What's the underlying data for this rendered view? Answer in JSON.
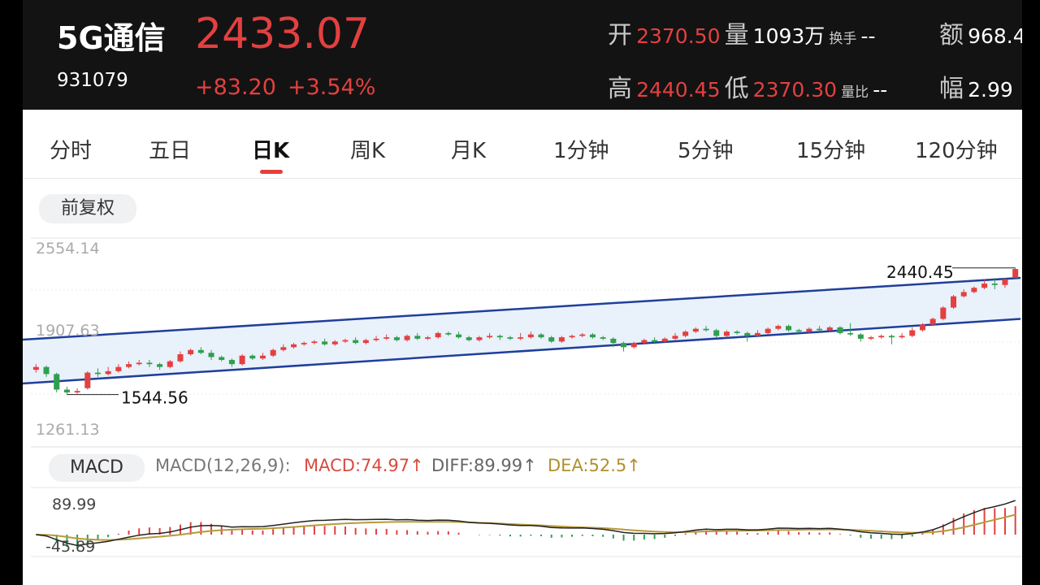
{
  "header": {
    "name": "5G通信",
    "code": "931079",
    "price": "2433.07",
    "change": "+83.20",
    "change_pct": "+3.54%",
    "open_label": "开",
    "open": "2370.50",
    "volume_label": "量",
    "volume": "1093万",
    "turnover_label": "换手",
    "turnover": "--",
    "amount_label": "额",
    "amount": "968.4",
    "high_label": "高",
    "high": "2440.45",
    "low_label": "低",
    "low": "2370.30",
    "vol_ratio_label": "量比",
    "vol_ratio": "--",
    "amplitude_label": "幅",
    "amplitude": "2.99"
  },
  "tabs": [
    "分时",
    "五日",
    "日K",
    "周K",
    "月K",
    "1分钟",
    "5分钟",
    "15分钟",
    "120分钟"
  ],
  "active_tab": "日K",
  "adjust_button": "前复权",
  "indicator": {
    "button": "MACD",
    "params": "MACD(12,26,9):",
    "macd": "MACD:74.97",
    "diff": "DIFF:89.99",
    "dea": "DEA:52.5",
    "arrow": "↑"
  },
  "colors": {
    "up": "#e34040",
    "down": "#2e9f4e",
    "channel": "#1f3f9a",
    "dea": "#b89a3a",
    "diff": "#222222"
  },
  "chart_data": {
    "type": "candlestick",
    "y_ticks": [
      "2554.14",
      "1907.63",
      "1261.13"
    ],
    "ylim": [
      1261.13,
      2554.14
    ],
    "annotations": {
      "max": "2440.45",
      "min": "1544.56"
    },
    "candles": [
      [
        1720,
        1740,
        1700,
        1760
      ],
      [
        1740,
        1690,
        1670,
        1750
      ],
      [
        1690,
        1580,
        1560,
        1700
      ],
      [
        1580,
        1560,
        1544.56,
        1600
      ],
      [
        1560,
        1570,
        1550,
        1590
      ],
      [
        1590,
        1700,
        1580,
        1710
      ],
      [
        1700,
        1690,
        1670,
        1730
      ],
      [
        1690,
        1710,
        1680,
        1740
      ],
      [
        1710,
        1740,
        1700,
        1760
      ],
      [
        1740,
        1760,
        1730,
        1780
      ],
      [
        1760,
        1770,
        1750,
        1790
      ],
      [
        1770,
        1760,
        1740,
        1790
      ],
      [
        1760,
        1740,
        1720,
        1770
      ],
      [
        1740,
        1780,
        1730,
        1790
      ],
      [
        1780,
        1830,
        1770,
        1850
      ],
      [
        1830,
        1860,
        1820,
        1870
      ],
      [
        1860,
        1840,
        1830,
        1880
      ],
      [
        1840,
        1810,
        1790,
        1860
      ],
      [
        1810,
        1790,
        1780,
        1820
      ],
      [
        1790,
        1760,
        1740,
        1800
      ],
      [
        1760,
        1820,
        1750,
        1830
      ],
      [
        1820,
        1800,
        1790,
        1830
      ],
      [
        1800,
        1820,
        1790,
        1840
      ],
      [
        1820,
        1860,
        1810,
        1870
      ],
      [
        1860,
        1880,
        1850,
        1900
      ],
      [
        1880,
        1900,
        1870,
        1910
      ],
      [
        1900,
        1910,
        1890,
        1920
      ],
      [
        1910,
        1920,
        1900,
        1930
      ],
      [
        1920,
        1900,
        1890,
        1940
      ],
      [
        1900,
        1920,
        1890,
        1930
      ],
      [
        1920,
        1930,
        1910,
        1940
      ],
      [
        1930,
        1910,
        1900,
        1950
      ],
      [
        1910,
        1930,
        1900,
        1940
      ],
      [
        1930,
        1940,
        1920,
        1960
      ],
      [
        1940,
        1950,
        1930,
        1970
      ],
      [
        1950,
        1930,
        1920,
        1960
      ],
      [
        1930,
        1960,
        1920,
        1970
      ],
      [
        1960,
        1940,
        1930,
        1980
      ],
      [
        1940,
        1950,
        1930,
        1960
      ],
      [
        1950,
        1980,
        1940,
        1990
      ],
      [
        1980,
        1970,
        1960,
        1990
      ],
      [
        1970,
        1950,
        1940,
        1990
      ],
      [
        1950,
        1930,
        1920,
        1960
      ],
      [
        1930,
        1950,
        1920,
        1960
      ],
      [
        1950,
        1960,
        1940,
        1980
      ],
      [
        1960,
        1950,
        1930,
        1970
      ],
      [
        1950,
        1940,
        1930,
        1960
      ],
      [
        1940,
        1950,
        1930,
        1980
      ],
      [
        1950,
        1970,
        1940,
        1990
      ],
      [
        1970,
        1950,
        1940,
        1980
      ],
      [
        1950,
        1920,
        1910,
        1960
      ],
      [
        1920,
        1950,
        1910,
        1960
      ],
      [
        1950,
        1960,
        1940,
        1970
      ],
      [
        1960,
        1970,
        1950,
        1980
      ],
      [
        1970,
        1950,
        1940,
        1980
      ],
      [
        1950,
        1940,
        1930,
        1960
      ],
      [
        1940,
        1910,
        1880,
        1950
      ],
      [
        1910,
        1880,
        1850,
        1920
      ],
      [
        1880,
        1910,
        1870,
        1920
      ],
      [
        1910,
        1930,
        1900,
        1940
      ],
      [
        1930,
        1920,
        1910,
        1950
      ],
      [
        1920,
        1940,
        1910,
        1950
      ],
      [
        1940,
        1960,
        1930,
        1980
      ],
      [
        1960,
        1990,
        1950,
        2000
      ],
      [
        1990,
        2010,
        1980,
        2020
      ],
      [
        2010,
        2000,
        1990,
        2030
      ],
      [
        2000,
        1960,
        1950,
        2010
      ],
      [
        1960,
        1990,
        1950,
        2000
      ],
      [
        1990,
        1980,
        1970,
        2000
      ],
      [
        1980,
        1960,
        1920,
        1990
      ],
      [
        1960,
        1980,
        1950,
        2000
      ],
      [
        1980,
        2010,
        1970,
        2020
      ],
      [
        2010,
        2030,
        2000,
        2040
      ],
      [
        2030,
        2000,
        1990,
        2040
      ],
      [
        2000,
        1990,
        1980,
        2010
      ],
      [
        1990,
        2010,
        1980,
        2020
      ],
      [
        2010,
        2000,
        1990,
        2030
      ],
      [
        2000,
        2020,
        1990,
        2030
      ],
      [
        2020,
        1980,
        1970,
        2030
      ],
      [
        1980,
        1970,
        1960,
        2050
      ],
      [
        1970,
        1940,
        1920,
        1980
      ],
      [
        1940,
        1950,
        1930,
        1960
      ],
      [
        1950,
        1960,
        1940,
        1970
      ],
      [
        1960,
        1950,
        1900,
        1970
      ],
      [
        1950,
        1960,
        1940,
        1980
      ],
      [
        1960,
        2000,
        1950,
        2020
      ],
      [
        2000,
        2040,
        1990,
        2050
      ],
      [
        2040,
        2080,
        2030,
        2090
      ],
      [
        2080,
        2160,
        2070,
        2170
      ],
      [
        2160,
        2240,
        2150,
        2250
      ],
      [
        2240,
        2270,
        2230,
        2290
      ],
      [
        2270,
        2300,
        2260,
        2310
      ],
      [
        2300,
        2330,
        2290,
        2360
      ],
      [
        2330,
        2320,
        2290,
        2370
      ],
      [
        2320,
        2360,
        2300,
        2370
      ],
      [
        2370.5,
        2433.07,
        2370.3,
        2440.45
      ]
    ],
    "channel_upper": [
      1930,
      2370
    ],
    "channel_lower": [
      1620,
      2080
    ],
    "macd": {
      "y_ticks": [
        "89.99",
        "-45.89"
      ],
      "ylim": [
        -55,
        105
      ],
      "diff_end": 89.99,
      "dea_end": 52.5,
      "macd_end": 74.97
    }
  }
}
